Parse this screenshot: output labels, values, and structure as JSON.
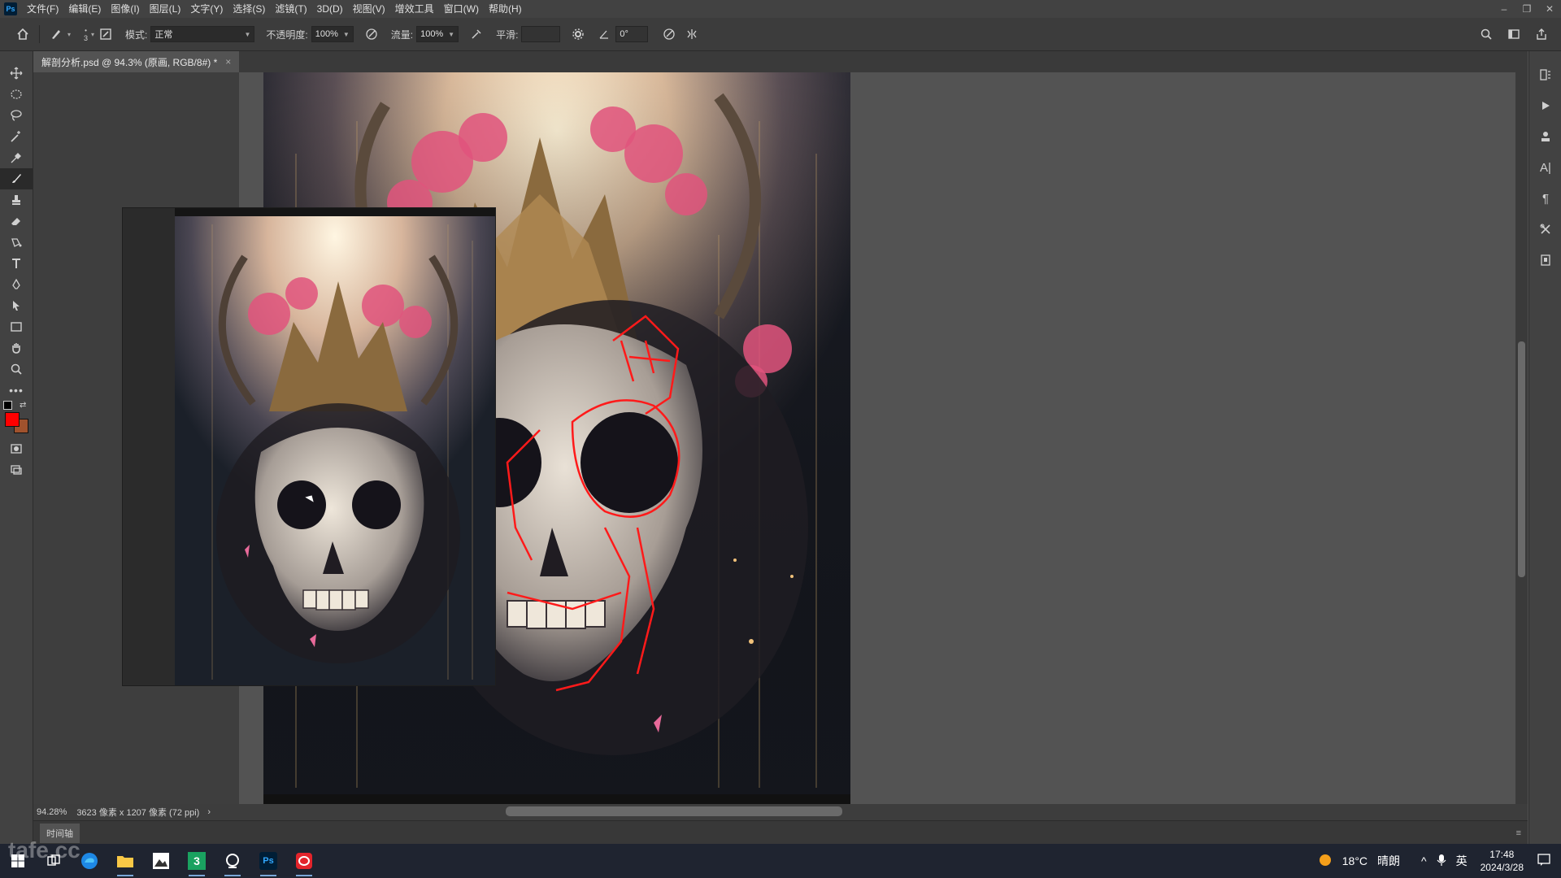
{
  "app": {
    "logo": "Ps"
  },
  "menu": [
    "文件(F)",
    "编辑(E)",
    "图像(I)",
    "图层(L)",
    "文字(Y)",
    "选择(S)",
    "滤镜(T)",
    "3D(D)",
    "视图(V)",
    "增效工具",
    "窗口(W)",
    "帮助(H)"
  ],
  "window_controls": {
    "minimize": "–",
    "restore": "❐",
    "close": "✕"
  },
  "options": {
    "brush_size": "3",
    "mode_label": "模式:",
    "mode_value": "正常",
    "opacity_label": "不透明度:",
    "opacity_value": "100%",
    "flow_label": "流量:",
    "flow_value": "100%",
    "smoothing_label": "平滑:",
    "smoothing_value": "",
    "angle_value": "0°"
  },
  "document": {
    "tab_title": "解剖分析.psd @ 94.3% (原画, RGB/8#) *",
    "tab_close": "×"
  },
  "colors": {
    "foreground": "#ff0000",
    "background": "#a0522d",
    "accent": "#31a8ff"
  },
  "status": {
    "zoom": "94.28%",
    "doc_info": "3623 像素 x 1207 像素 (72 ppi)",
    "arrow": "›"
  },
  "timeline": {
    "label": "时间轴"
  },
  "taskbar": {
    "apps": [
      "start-icon",
      "task-view-icon",
      "edge-icon",
      "file-explorer-icon",
      "gallery-icon",
      "app-3-icon",
      "search-app-icon",
      "photoshop-icon",
      "opera-icon"
    ],
    "photoshop_label": "Ps"
  },
  "tray": {
    "temperature": "18°C",
    "weather": "晴朗",
    "language": "英",
    "time": "17:48",
    "date": "2024/3/28"
  },
  "watermark": "tafe.cc"
}
